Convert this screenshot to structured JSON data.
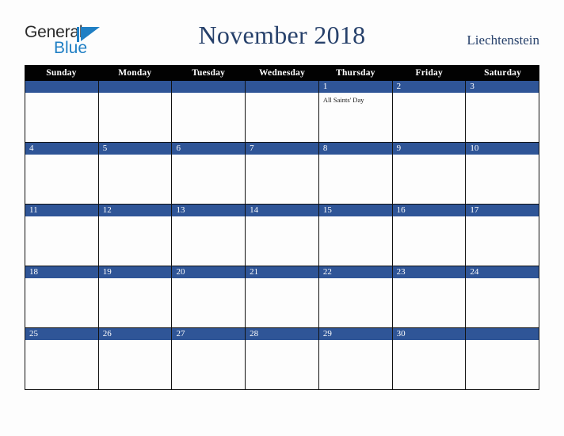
{
  "brand": {
    "line1": "General",
    "line2": "Blue",
    "accent_color": "#1f7fc4",
    "text_color": "#2b2b2b"
  },
  "header": {
    "title": "November 2018",
    "country": "Liechtenstein",
    "title_color": "#27416b"
  },
  "calendar": {
    "weekday_headers": [
      "Sunday",
      "Monday",
      "Tuesday",
      "Wednesday",
      "Thursday",
      "Friday",
      "Saturday"
    ],
    "header_bg": "#020202",
    "daynum_bg": "#2f5597",
    "daynum_color": "#ffffff",
    "weeks": [
      [
        {
          "day": "",
          "events": []
        },
        {
          "day": "",
          "events": []
        },
        {
          "day": "",
          "events": []
        },
        {
          "day": "",
          "events": []
        },
        {
          "day": "1",
          "events": [
            "All Saints' Day"
          ]
        },
        {
          "day": "2",
          "events": []
        },
        {
          "day": "3",
          "events": []
        }
      ],
      [
        {
          "day": "4",
          "events": []
        },
        {
          "day": "5",
          "events": []
        },
        {
          "day": "6",
          "events": []
        },
        {
          "day": "7",
          "events": []
        },
        {
          "day": "8",
          "events": []
        },
        {
          "day": "9",
          "events": []
        },
        {
          "day": "10",
          "events": []
        }
      ],
      [
        {
          "day": "11",
          "events": []
        },
        {
          "day": "12",
          "events": []
        },
        {
          "day": "13",
          "events": []
        },
        {
          "day": "14",
          "events": []
        },
        {
          "day": "15",
          "events": []
        },
        {
          "day": "16",
          "events": []
        },
        {
          "day": "17",
          "events": []
        }
      ],
      [
        {
          "day": "18",
          "events": []
        },
        {
          "day": "19",
          "events": []
        },
        {
          "day": "20",
          "events": []
        },
        {
          "day": "21",
          "events": []
        },
        {
          "day": "22",
          "events": []
        },
        {
          "day": "23",
          "events": []
        },
        {
          "day": "24",
          "events": []
        }
      ],
      [
        {
          "day": "25",
          "events": []
        },
        {
          "day": "26",
          "events": []
        },
        {
          "day": "27",
          "events": []
        },
        {
          "day": "28",
          "events": []
        },
        {
          "day": "29",
          "events": []
        },
        {
          "day": "30",
          "events": []
        },
        {
          "day": "",
          "events": []
        }
      ]
    ]
  }
}
